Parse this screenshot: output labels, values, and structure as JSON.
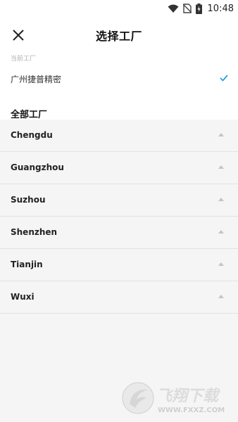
{
  "status_bar": {
    "time": "10:48"
  },
  "header": {
    "title": "选择工厂"
  },
  "current": {
    "label": "当前工厂",
    "factory": "广州捷普精密"
  },
  "all": {
    "label": "全部工厂",
    "cities": [
      "Chengdu",
      "Guangzhou",
      "Suzhou",
      "Shenzhen",
      "Tianjin",
      "Wuxi"
    ]
  },
  "watermark": {
    "brand": "飞翔下载",
    "url": "WWW.FXXZ.COM"
  },
  "colors": {
    "accent": "#2aa0e0",
    "background": "#f5f5f5",
    "divider": "#e2e2e2"
  }
}
